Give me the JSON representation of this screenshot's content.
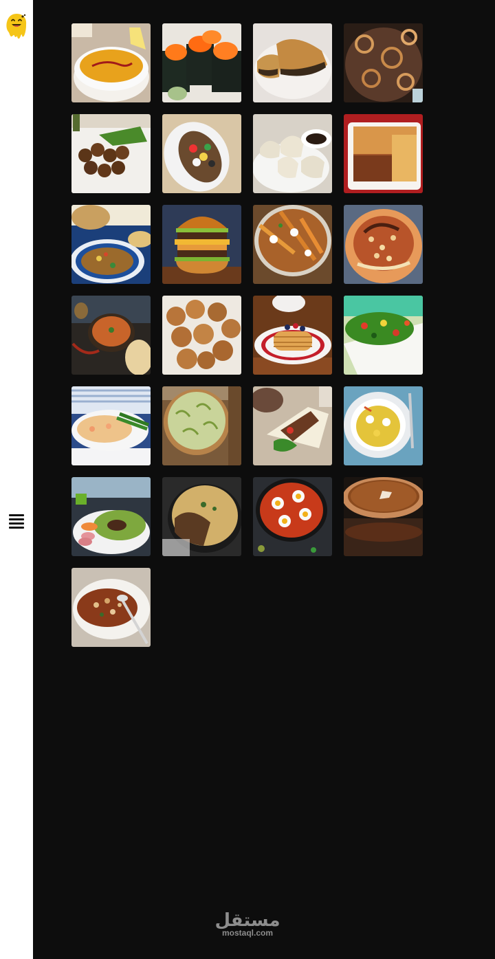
{
  "sidebar": {
    "logo_icon": "melting-smiley-icon",
    "menu_icon": "hamburger-menu-icon"
  },
  "gallery": {
    "items": [
      {
        "icon": "lentil-soup-image"
      },
      {
        "icon": "sushi-image"
      },
      {
        "icon": "hawawshi-image"
      },
      {
        "icon": "liver-onions-image"
      },
      {
        "icon": "falafel-image"
      },
      {
        "icon": "stuffed-potato-image"
      },
      {
        "icon": "dumplings-image"
      },
      {
        "icon": "lasagna-image"
      },
      {
        "icon": "vegetable-stew-image"
      },
      {
        "icon": "burger-image"
      },
      {
        "icon": "loaded-fries-image"
      },
      {
        "icon": "koshari-image"
      },
      {
        "icon": "curry-image"
      },
      {
        "icon": "fried-dough-image"
      },
      {
        "icon": "pancakes-image"
      },
      {
        "icon": "salad-image"
      },
      {
        "icon": "fish-pie-image"
      },
      {
        "icon": "quiche-image"
      },
      {
        "icon": "shawarma-wrap-image"
      },
      {
        "icon": "egg-rice-image"
      },
      {
        "icon": "peas-sausage-image"
      },
      {
        "icon": "skillet-pie-image"
      },
      {
        "icon": "shakshuka-image"
      },
      {
        "icon": "pumpkin-pie-image"
      },
      {
        "icon": "bean-soup-image"
      }
    ]
  },
  "watermark": {
    "arabic": "مستقل",
    "latin": "mostaql.com"
  },
  "colors": {
    "background": "#0d0d0d",
    "sidebar": "#ffffff"
  }
}
